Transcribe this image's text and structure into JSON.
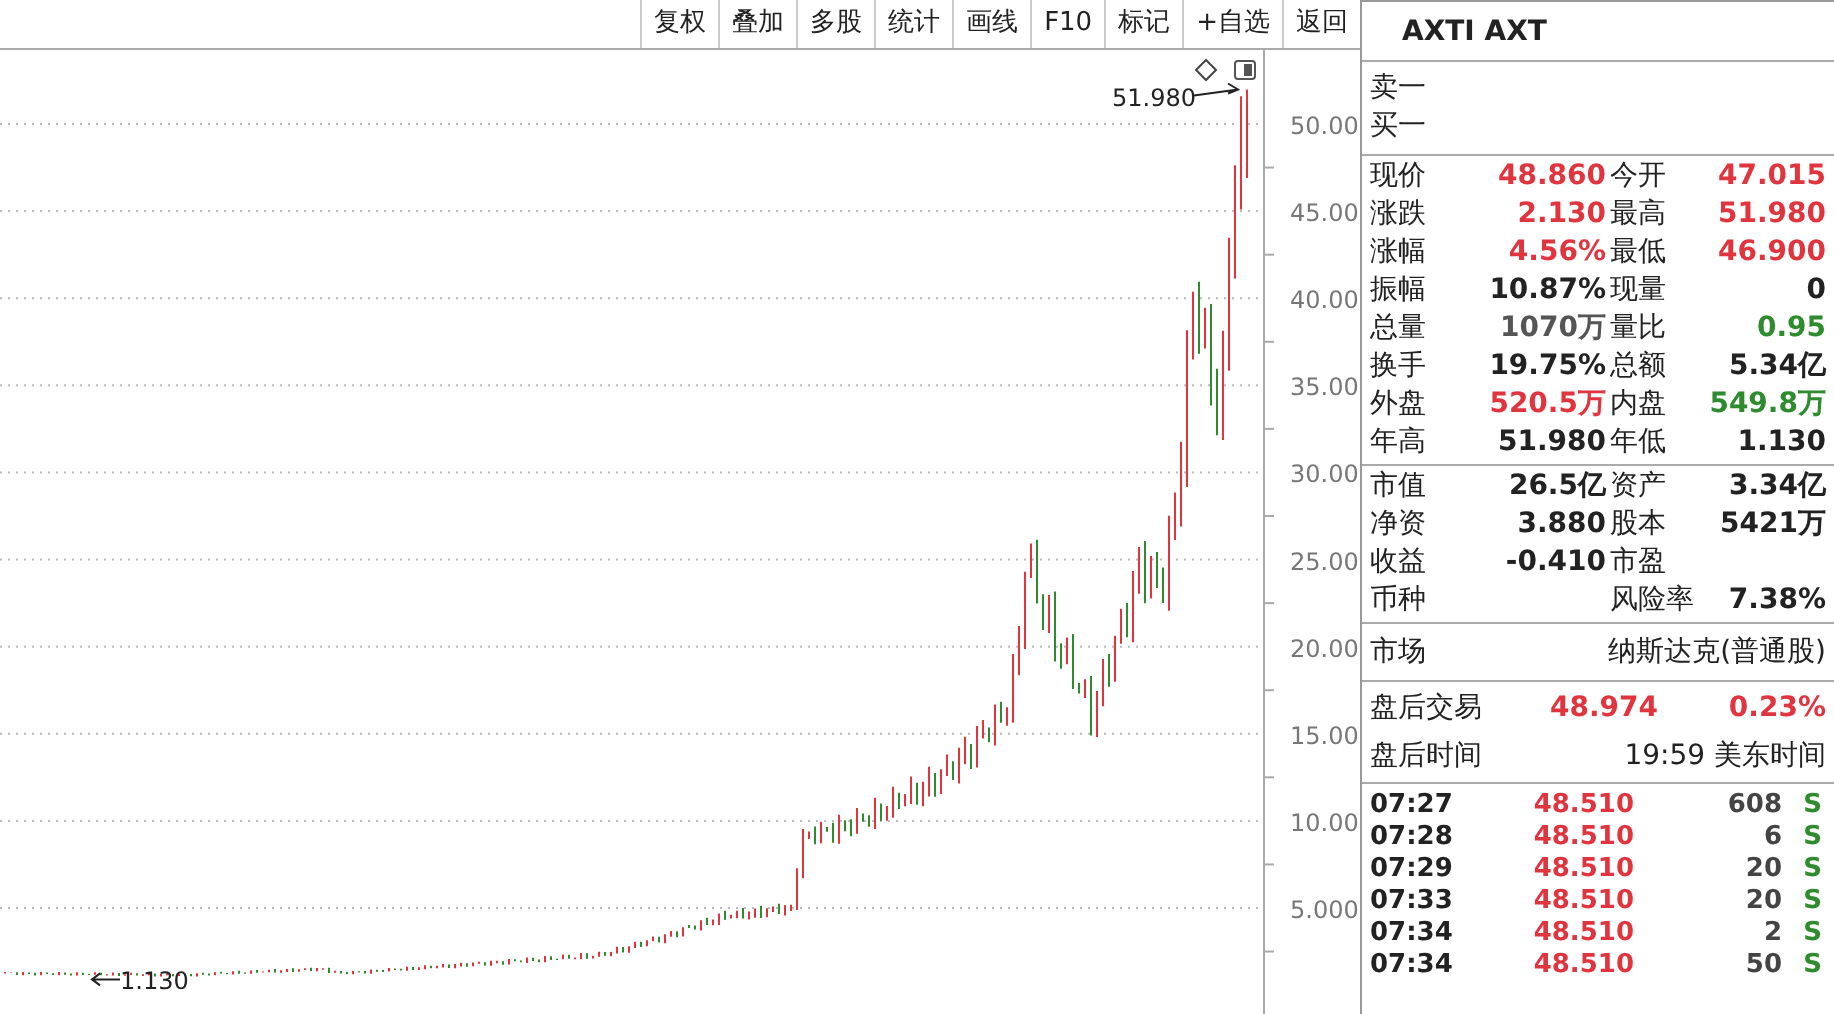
{
  "toolbar": [
    "复权",
    "叠加",
    "多股",
    "统计",
    "画线",
    "F10",
    "标记",
    "+自选",
    "返回"
  ],
  "chart": {
    "yticks": [
      "50.00",
      "45.00",
      "40.00",
      "35.00",
      "30.00",
      "25.00",
      "20.00",
      "15.00",
      "10.00",
      "5.000"
    ],
    "high_label": "51.980",
    "low_label": "1.130"
  },
  "title": "AXTI AXT",
  "orderbook": [
    {
      "label": "卖一"
    },
    {
      "label": "买一"
    }
  ],
  "quote": [
    [
      {
        "label": "现价",
        "value": "48.860",
        "color": "#e0343e"
      },
      {
        "label": "今开",
        "value": "47.015",
        "color": "#e0343e"
      }
    ],
    [
      {
        "label": "涨跌",
        "value": "2.130",
        "color": "#e0343e"
      },
      {
        "label": "最高",
        "value": "51.980",
        "color": "#e0343e"
      }
    ],
    [
      {
        "label": "涨幅",
        "value": "4.56%",
        "color": "#e0343e"
      },
      {
        "label": "最低",
        "value": "46.900",
        "color": "#e0343e"
      }
    ],
    [
      {
        "label": "振幅",
        "value": "10.87%",
        "color": "#222222"
      },
      {
        "label": "现量",
        "value": "0",
        "color": "#222222"
      }
    ],
    [
      {
        "label": "总量",
        "value": "1070万",
        "color": "#555555"
      },
      {
        "label": "量比",
        "value": "0.95",
        "color": "#2e8b2e"
      }
    ],
    [
      {
        "label": "换手",
        "value": "19.75%",
        "color": "#222222"
      },
      {
        "label": "总额",
        "value": "5.34亿",
        "color": "#222222"
      }
    ],
    [
      {
        "label": "外盘",
        "value": "520.5万",
        "color": "#e0343e"
      },
      {
        "label": "内盘",
        "value": "549.8万",
        "color": "#2e8b2e"
      }
    ],
    [
      {
        "label": "年高",
        "value": "51.980",
        "color": "#222222"
      },
      {
        "label": "年低",
        "value": "1.130",
        "color": "#222222"
      }
    ]
  ],
  "fundamentals": [
    [
      {
        "label": "市值",
        "value": "26.5亿"
      },
      {
        "label": "资产",
        "value": "3.34亿"
      }
    ],
    [
      {
        "label": "净资",
        "value": "3.880"
      },
      {
        "label": "股本",
        "value": "5421万"
      }
    ],
    [
      {
        "label": "收益",
        "value": "-0.410"
      },
      {
        "label": "市盈"
      }
    ],
    [
      {
        "label": "币种"
      },
      {
        "label": "风险率",
        "value": "7.38%"
      }
    ]
  ],
  "market": {
    "label": "市场",
    "value": "纳斯达克(普通股)"
  },
  "after_hours": {
    "label": "盘后交易",
    "price": "48.974",
    "change": "0.23%",
    "time_label": "盘后时间",
    "time": "19:59 美东时间"
  },
  "trades": [
    {
      "time": "07:27",
      "price": "48.510",
      "volume": "608",
      "side": "S"
    },
    {
      "time": "07:28",
      "price": "48.510",
      "volume": "6",
      "side": "S"
    },
    {
      "time": "07:29",
      "price": "48.510",
      "volume": "20",
      "side": "S"
    },
    {
      "time": "07:33",
      "price": "48.510",
      "volume": "20",
      "side": "S"
    },
    {
      "time": "07:34",
      "price": "48.510",
      "volume": "2",
      "side": "S"
    },
    {
      "time": "07:34",
      "price": "48.510",
      "volume": "50",
      "side": "S"
    }
  ]
}
